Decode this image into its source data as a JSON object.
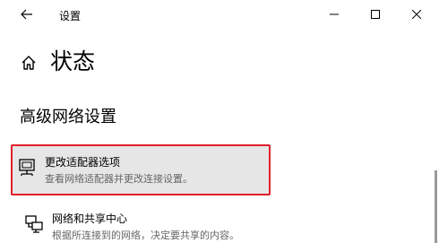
{
  "window": {
    "title": "设置",
    "back_icon": "back-arrow-icon",
    "controls": [
      "minimize-icon",
      "maximize-icon",
      "close-icon"
    ]
  },
  "header": {
    "home_icon": "home-icon",
    "page_title": "状态"
  },
  "section": {
    "title": "高级网络设置"
  },
  "cards": [
    {
      "icon": "network-adapter-icon",
      "title": "更改适配器选项",
      "description": "查看网络适配器并更改连接设置。",
      "highlighted": true,
      "highlight_color": "#e0202a"
    },
    {
      "icon": "network-sharing-center-icon",
      "title": "网络和共享中心",
      "description": "根据所连接到的网络，决定要共享的内容。",
      "highlighted": false
    }
  ]
}
